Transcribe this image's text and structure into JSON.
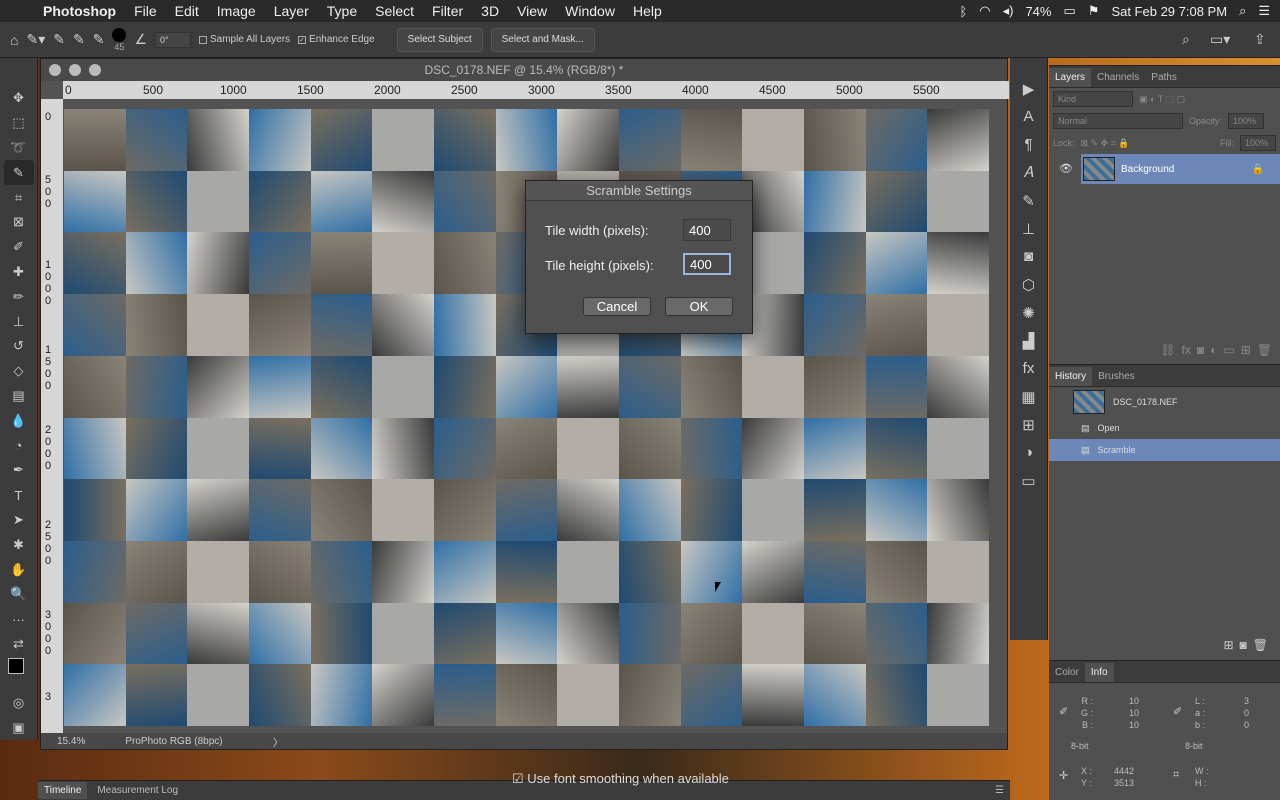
{
  "menubar": {
    "app": "Photoshop",
    "items": [
      "File",
      "Edit",
      "Image",
      "Layer",
      "Type",
      "Select",
      "Filter",
      "3D",
      "View",
      "Window",
      "Help"
    ],
    "battery": "74%",
    "datetime": "Sat Feb 29  7:08 PM"
  },
  "options": {
    "brush_size": "45",
    "angle": "0°",
    "sample_all_layers": "Sample All Layers",
    "enhance_edge": "Enhance Edge",
    "select_subject": "Select Subject",
    "select_and_mask": "Select and Mask..."
  },
  "document": {
    "title": "DSC_0178.NEF @ 15.4% (RGB/8*) *",
    "zoom": "15.4%",
    "profile": "ProPhoto RGB (8bpc)",
    "ruler_h": [
      "0",
      "500",
      "1000",
      "1500",
      "2000",
      "2500",
      "3000",
      "3500",
      "4000",
      "4500",
      "5000",
      "5500"
    ],
    "ruler_v": [
      "0",
      "5 0 0",
      "1 0 0 0",
      "1 5 0 0",
      "2 0 0 0",
      "2 5 0 0",
      "3 0 0 0",
      "3"
    ]
  },
  "dialog": {
    "title": "Scramble Settings",
    "tile_width_label": "Tile width (pixels):",
    "tile_width": "400",
    "tile_height_label": "Tile height (pixels):",
    "tile_height": "400",
    "cancel": "Cancel",
    "ok": "OK"
  },
  "layers": {
    "tabs": [
      "Layers",
      "Channels",
      "Paths"
    ],
    "kind": "Kind",
    "blend": "Normal",
    "opacity_label": "Opacity:",
    "opacity": "100%",
    "lock_label": "Lock:",
    "fill_label": "Fill:",
    "fill": "100%",
    "layer_name": "Background"
  },
  "history": {
    "tabs": [
      "History",
      "Brushes"
    ],
    "snapshot": "DSC_0178.NEF",
    "items": [
      "Open",
      "Scramble"
    ]
  },
  "info": {
    "tabs": [
      "Color",
      "Info"
    ],
    "R": "10",
    "G": "10",
    "B": "10",
    "L": "3",
    "a": "0",
    "b": "0",
    "bit1": "8-bit",
    "bit2": "8-bit",
    "X": "4442",
    "Y": "3513",
    "rgb_labels": [
      "R :",
      "G :",
      "B :"
    ],
    "lab_labels": [
      "L :",
      "a :",
      "b :"
    ],
    "xy_labels": [
      "X :",
      "Y :"
    ],
    "wh_labels": [
      "W :",
      "H :"
    ]
  },
  "bottom": {
    "tabs": [
      "Timeline",
      "Measurement Log"
    ],
    "smoothing": "Use font smoothing when available"
  }
}
